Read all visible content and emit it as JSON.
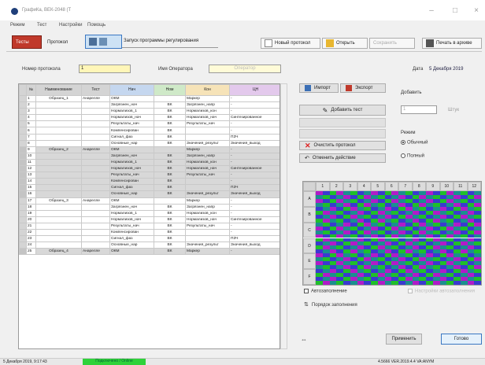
{
  "window": {
    "title": "ГрафиКа, ВЕК-2048 (Т"
  },
  "menu": [
    "Режим",
    "Тест",
    "Настройки",
    "Помощь"
  ],
  "toolbar": {
    "tests_label": "Тесты",
    "protocol_label": "Протокол",
    "tab_label": "Запуск программы регулирования",
    "new_label": "Новый протокол",
    "open_label": "Открыть",
    "save_label": "Сохранить",
    "print_label": "Печать в архиве"
  },
  "header": {
    "protocol_no_label": "Номер протокола",
    "protocol_no_value": "1",
    "operator_label": "Имя Оператора",
    "operator_value": "Оператор",
    "date_label": "Дата",
    "date_value": "5 Декабря 2019"
  },
  "grid": {
    "columns": [
      "№",
      "Наименование",
      "Тест",
      "Нач",
      "Ном",
      "Кон",
      "ЦН"
    ],
    "rows": [
      {
        "n": "1",
        "name": "Образец_1",
        "test": "Анарелле",
        "a": "ОКМ",
        "b": "",
        "c": "Маркер",
        "d": "-",
        "shade": false
      },
      {
        "n": "2",
        "name": "",
        "test": "",
        "a": "Загрязнен_нач",
        "b": "ВК",
        "c": "Загрязнен_напр",
        "d": "-",
        "shade": false
      },
      {
        "n": "3",
        "name": "",
        "test": "",
        "a": "Нормализов_1",
        "b": "ВК",
        "c": "Нормализов_кон",
        "d": "-",
        "shade": false
      },
      {
        "n": "4",
        "name": "",
        "test": "",
        "a": "Нормализов_нач",
        "b": "ВК",
        "c": "Нормализов_нач",
        "d": "Синтезированное",
        "shade": false
      },
      {
        "n": "5",
        "name": "",
        "test": "",
        "a": "Результаты_нач",
        "b": "ВК",
        "c": "Результаты_нач",
        "d": "-",
        "shade": false
      },
      {
        "n": "6",
        "name": "",
        "test": "",
        "a": "Компенсирован",
        "b": "ВК",
        "c": "",
        "d": "-",
        "shade": false
      },
      {
        "n": "7",
        "name": "",
        "test": "",
        "a": "Сигнал_фаз",
        "b": "ВК",
        "c": "",
        "d": "ПЗЧ",
        "shade": false
      },
      {
        "n": "8",
        "name": "",
        "test": "",
        "a": "Основные_нар",
        "b": "ВК",
        "c": "Значения_результ",
        "d": "Значения_выход",
        "shade": false
      },
      {
        "n": "9",
        "name": "Образец_2",
        "test": "Анарелле",
        "a": "ОКМ",
        "b": "",
        "c": "Маркер",
        "d": "-",
        "shade": true
      },
      {
        "n": "10",
        "name": "",
        "test": "",
        "a": "Загрязнен_нач",
        "b": "ВК",
        "c": "Загрязнен_напр",
        "d": "-",
        "shade": true
      },
      {
        "n": "11",
        "name": "",
        "test": "",
        "a": "Нормализов_1",
        "b": "ВК",
        "c": "Нормализов_кон",
        "d": "-",
        "shade": true
      },
      {
        "n": "12",
        "name": "",
        "test": "",
        "a": "Нормализов_нач",
        "b": "ВК",
        "c": "Нормализов_нач",
        "d": "Синтезированное",
        "shade": true
      },
      {
        "n": "13",
        "name": "",
        "test": "",
        "a": "Результаты_нач",
        "b": "ВК",
        "c": "Результаты_нач",
        "d": "-",
        "shade": true
      },
      {
        "n": "14",
        "name": "",
        "test": "",
        "a": "Компенсирован",
        "b": "ВК",
        "c": "",
        "d": "-",
        "shade": true
      },
      {
        "n": "15",
        "name": "",
        "test": "",
        "a": "Сигнал_фаз",
        "b": "ВК",
        "c": "",
        "d": "ПЗЧ",
        "shade": true
      },
      {
        "n": "16",
        "name": "",
        "test": "",
        "a": "Основные_нар",
        "b": "ВК",
        "c": "Значения_результ",
        "d": "Значения_выход",
        "shade": true
      },
      {
        "n": "17",
        "name": "Образец_3",
        "test": "Анарелле",
        "a": "ОКМ",
        "b": "",
        "c": "Маркер",
        "d": "-",
        "shade": false
      },
      {
        "n": "18",
        "name": "",
        "test": "",
        "a": "Загрязнен_нач",
        "b": "ВК",
        "c": "Загрязнен_напр",
        "d": "-",
        "shade": false
      },
      {
        "n": "19",
        "name": "",
        "test": "",
        "a": "Нормализов_1",
        "b": "ВК",
        "c": "Нормализов_кон",
        "d": "-",
        "shade": false
      },
      {
        "n": "20",
        "name": "",
        "test": "",
        "a": "Нормализов_нач",
        "b": "ВК",
        "c": "Нормализов_нач",
        "d": "Синтезированное",
        "shade": false
      },
      {
        "n": "21",
        "name": "",
        "test": "",
        "a": "Результаты_нач",
        "b": "ВК",
        "c": "Результаты_нач",
        "d": "-",
        "shade": false
      },
      {
        "n": "22",
        "name": "",
        "test": "",
        "a": "Компенсирован",
        "b": "ВК",
        "c": "",
        "d": "-",
        "shade": false
      },
      {
        "n": "23",
        "name": "",
        "test": "",
        "a": "Сигнал_фаз",
        "b": "ВК",
        "c": "",
        "d": "ПЗЧ",
        "shade": false
      },
      {
        "n": "24",
        "name": "",
        "test": "",
        "a": "Основные_нар",
        "b": "ВК",
        "c": "Значения_результ",
        "d": "Значения_выход",
        "shade": false
      },
      {
        "n": "25",
        "name": "Образец_4",
        "test": "Анарелле",
        "a": "ОКМ",
        "b": "ВК",
        "c": "Маркер",
        "d": "-",
        "shade": true
      }
    ]
  },
  "side": {
    "import_label": "Импорт",
    "export_label": "Экспорт",
    "add_test_label": "Добавить тест",
    "clear_label": "Очистить протокол",
    "undo_label": "Отменить действие",
    "add_label": "Добавить",
    "add_count_value": "1",
    "add_unit": "Штук",
    "mode_label": "Режим",
    "mode_normal": "Обычный",
    "mode_full": "Полный"
  },
  "map": {
    "col_headers": [
      "1",
      "2",
      "3",
      "4",
      "5",
      "6",
      "7",
      "8",
      "9",
      "10",
      "11",
      "12"
    ],
    "row_headers": [
      "А",
      "B",
      "C",
      "D",
      "E",
      "F"
    ],
    "colors": [
      "#b01cc8",
      "#1fbf2a",
      "#1a8f8f",
      "#3a3ad0"
    ]
  },
  "options": {
    "autofill_label": "Автозаполнение",
    "order_label": "Порядок заполнения",
    "right_option": "Настройки автозаполнения"
  },
  "footer": {
    "apply_label": "Применить",
    "ok_label": "Готово"
  },
  "status": {
    "left": "5 Декабря 2019, 9:17:43",
    "badge": "Подключено / Online",
    "right": "4.5666  VER.2019.4.4 VA:ANYM"
  }
}
